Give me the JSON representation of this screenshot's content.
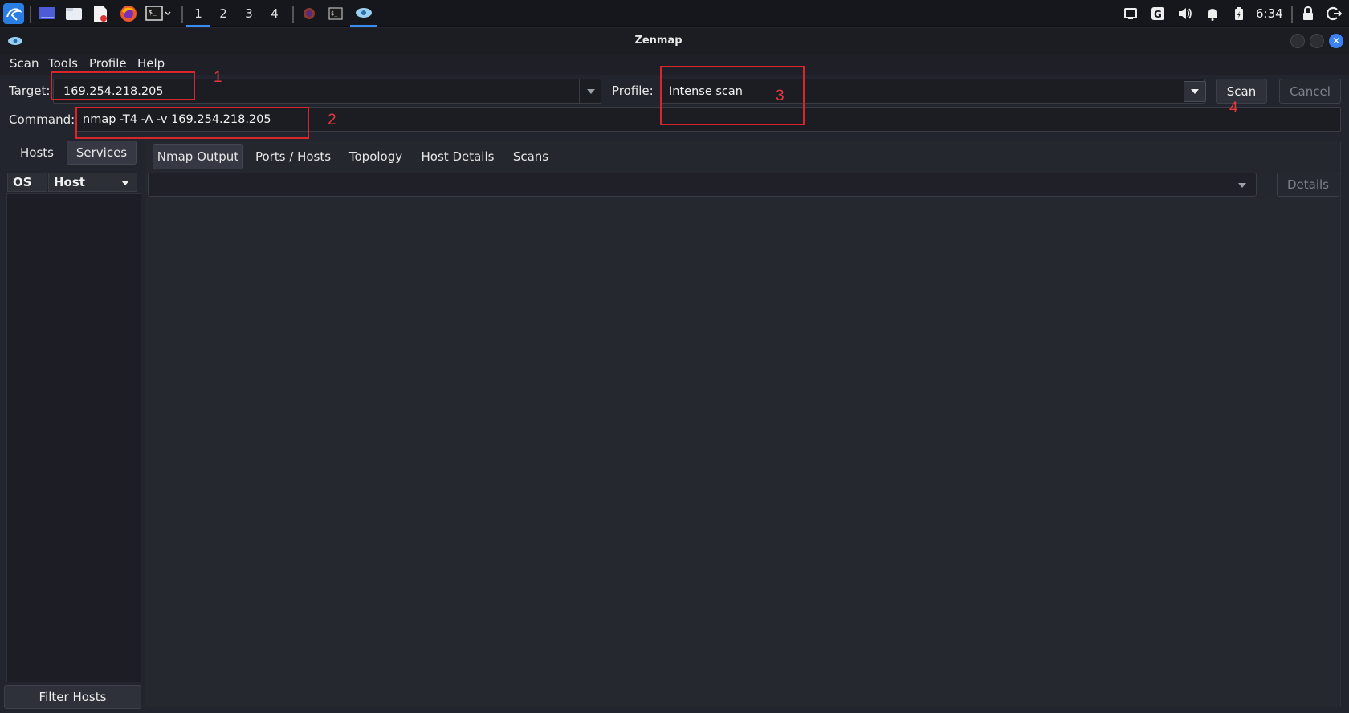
{
  "taskbar": {
    "workspaces": [
      "1",
      "2",
      "3",
      "4"
    ],
    "active_workspace": "1",
    "clock": "6:34",
    "icons": [
      "kali-menu-icon",
      "show-desktop-icon",
      "file-manager-icon",
      "text-editor-icon",
      "firefox-icon",
      "terminal-icon"
    ]
  },
  "window": {
    "title": "Zenmap"
  },
  "menu": {
    "items": [
      "Scan",
      "Tools",
      "Profile",
      "Help"
    ]
  },
  "target": {
    "label": "Target:",
    "value": "169.254.218.205"
  },
  "profile": {
    "label": "Profile:",
    "value": "Intense scan"
  },
  "command": {
    "label": "Command:",
    "value": "nmap -T4 -A -v 169.254.218.205"
  },
  "buttons": {
    "scan": "Scan",
    "cancel": "Cancel",
    "details": "Details",
    "filter_hosts": "Filter Hosts"
  },
  "left_panel": {
    "tabs": [
      "Hosts",
      "Services"
    ],
    "active_tab": "Services",
    "columns": [
      "OS",
      "Host"
    ]
  },
  "right_panel": {
    "tabs": [
      "Nmap Output",
      "Ports / Hosts",
      "Topology",
      "Host Details",
      "Scans"
    ],
    "active_tab": "Nmap Output"
  },
  "annotations": [
    "1",
    "2",
    "3",
    "4"
  ],
  "colors": {
    "annotation": "#d8272c",
    "accent": "#3b82f6",
    "background": "#23252e"
  }
}
